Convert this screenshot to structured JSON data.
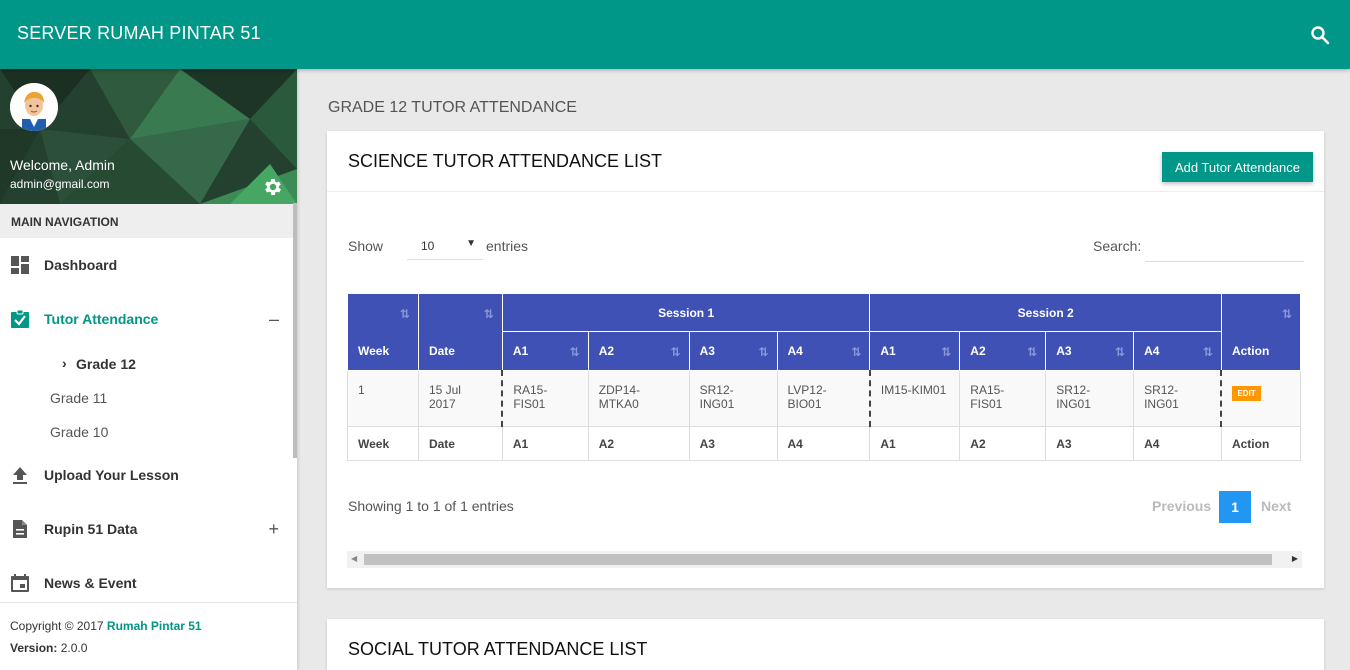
{
  "app": {
    "title": "SERVER RUMAH PINTAR 51"
  },
  "user": {
    "welcome": "Welcome, Admin",
    "email": "admin@gmail.com"
  },
  "nav": {
    "header": "MAIN NAVIGATION",
    "items": [
      {
        "label": "Dashboard",
        "icon": "dashboard-icon"
      },
      {
        "label": "Tutor Attendance",
        "icon": "assignment-check-icon",
        "toggle": "–",
        "active": true
      },
      {
        "label": "Upload Your Lesson",
        "icon": "upload-icon"
      },
      {
        "label": "Rupin 51 Data",
        "icon": "document-icon",
        "toggle": "+"
      },
      {
        "label": "News & Event",
        "icon": "calendar-icon"
      }
    ],
    "sub_items": [
      {
        "label": "Grade 12",
        "active": true
      },
      {
        "label": "Grade 11"
      },
      {
        "label": "Grade 10"
      }
    ]
  },
  "legal": {
    "copyright_prefix": "Copyright © 2017",
    "copyright_link": "Rumah Pintar 51",
    "version_label": "Version:",
    "version_value": "2.0.0"
  },
  "page": {
    "title": "GRADE 12 TUTOR ATTENDANCE"
  },
  "science_card": {
    "title": "SCIENCE TUTOR ATTENDANCE LIST",
    "add_button": "Add Tutor Attendance",
    "show_label": "Show",
    "page_length": "10",
    "entries_label": "entries",
    "search_label": "Search:",
    "search_value": "",
    "table": {
      "groups": [
        "Session 1",
        "Session 2"
      ],
      "columns": [
        "Week",
        "Date",
        "A1",
        "A2",
        "A3",
        "A4",
        "A1",
        "A2",
        "A3",
        "A4",
        "Action"
      ],
      "rows": [
        {
          "week": "1",
          "date_line1": "15 Jul",
          "date_line2": "2017",
          "s1": [
            "RA15-",
            "ZDP14-MTKA0",
            "SR12-ING01",
            "LVP12-BIO01"
          ],
          "s1_a1_line2": "FIS01",
          "s2": [
            "IM15-KIM01",
            "RA15-FIS01",
            "SR12-ING01",
            "SR12-ING01"
          ],
          "action": "EDIT"
        }
      ]
    },
    "info": "Showing 1 to 1 of 1 entries",
    "pager": {
      "previous": "Previous",
      "current": "1",
      "next": "Next"
    }
  },
  "social_card": {
    "title": "SOCIAL TUTOR ATTENDANCE LIST"
  },
  "colors": {
    "primary": "#009688",
    "table_header": "#3f51b5",
    "pager_active": "#2196f3",
    "edit_badge": "#ff9800"
  }
}
